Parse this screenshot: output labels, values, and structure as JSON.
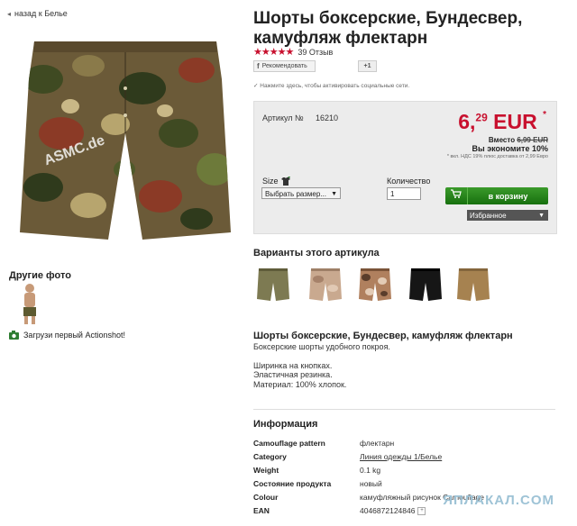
{
  "nav": {
    "back_label": "назад к Белье"
  },
  "product": {
    "title": "Шорты боксерские, Бундесвер, камуфляж флектарн",
    "stars": "★★★★★",
    "reviews": "39 Отзыв",
    "recommend_label": "Рекомендовать",
    "gplus_label": "+1",
    "social_note": "✓ Нажмите здесь, чтобы активировать социальные сети."
  },
  "price_box": {
    "article_label": "Артикул №",
    "article_no": "16210",
    "price_main": "6,",
    "price_cents": "29",
    "price_currency": " EUR",
    "price_star": "*",
    "instead_label": "Вместо",
    "old_price": "6,99 EUR",
    "save_text": "Вы экономите 10%",
    "vat_text": "* вкл. НДС 19% плюс доставка от 2,99 Евро",
    "size_label": "Size",
    "size_select": "Выбрать размер...",
    "qty_label": "Количество",
    "qty_value": "1",
    "cart_label": "в корзину",
    "fav_label": "Избранное"
  },
  "left": {
    "other_photos": "Другие фото",
    "actionshot": "Загрузи первый Actionshot!"
  },
  "variants": {
    "title": "Варианты этого артикула",
    "items": [
      {
        "name": "olive",
        "color": "#7d7a52"
      },
      {
        "name": "desert",
        "color": "#c9a98f"
      },
      {
        "name": "tropical-camo",
        "color": "#b0805e"
      },
      {
        "name": "black",
        "color": "#161616"
      },
      {
        "name": "coyote",
        "color": "#a68250"
      }
    ]
  },
  "description": {
    "title": "Шорты боксерские, Бундесвер, камуфляж флектарн",
    "intro": "Боксерские шорты удобного покроя.",
    "line1": "Ширинка на кнопках.",
    "line2": "Эластичная резинка.",
    "line3": "Материал: 100% хлопок."
  },
  "info": {
    "title": "Информация",
    "rows": [
      {
        "k": "Camouflage pattern",
        "v": "флектарн"
      },
      {
        "k": "Category",
        "v": "Линия одежды 1/Белье"
      },
      {
        "k": "Weight",
        "v": "0.1 kg"
      },
      {
        "k": "Состояние продукта",
        "v": "новый"
      },
      {
        "k": "Colour",
        "v": "камуфляжный рисунок Camouflage"
      },
      {
        "k": "EAN",
        "v": "4046872124846"
      }
    ]
  },
  "watermark": "ЯПЛАКАЛ.COM",
  "image_watermark": "ASMC.de",
  "colors": {
    "accent_red": "#c8102e",
    "cart_green": "#17700f"
  }
}
